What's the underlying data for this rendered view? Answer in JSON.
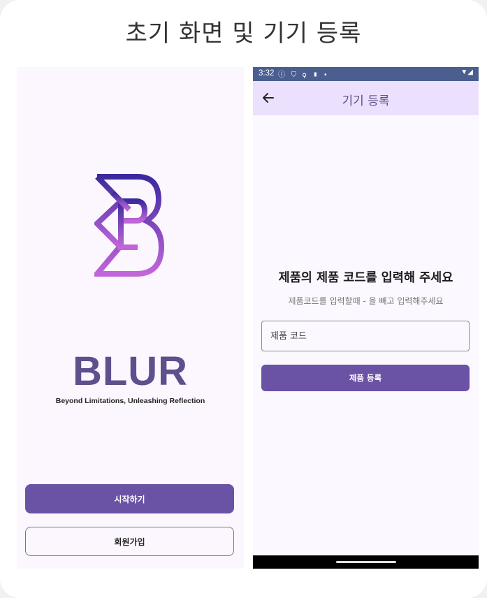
{
  "page_title": "초기 화면 및 기기 등록",
  "splash": {
    "brand_name": "BLUR",
    "tagline": "Beyond Limitations, Unleashing Reflection",
    "start_button": "시작하기",
    "signup_button": "회원가입"
  },
  "register": {
    "status_bar": {
      "time": "3:32",
      "left_icons": "ⓘ ⛉ ⚲ ▮ •",
      "right_icons": "▼◢"
    },
    "app_bar": {
      "back_icon": "arrow-left-icon",
      "title": "기기 등록"
    },
    "heading": "제품의 제품 코드를 입력해 주세요",
    "subheading": "제품코드를 입력할때 - 을 빼고 입력해주세요",
    "input": {
      "placeholder": "제품 코드",
      "value": ""
    },
    "submit_button": "제품 등록"
  },
  "colors": {
    "primary": "#6a52a4",
    "brand_text": "#5f4f8c",
    "logo_gradient_top": "#3b2a9e",
    "logo_gradient_bottom": "#c166d9",
    "app_bar": "#ebe1fe",
    "status_bar": "#4a5e8f"
  }
}
